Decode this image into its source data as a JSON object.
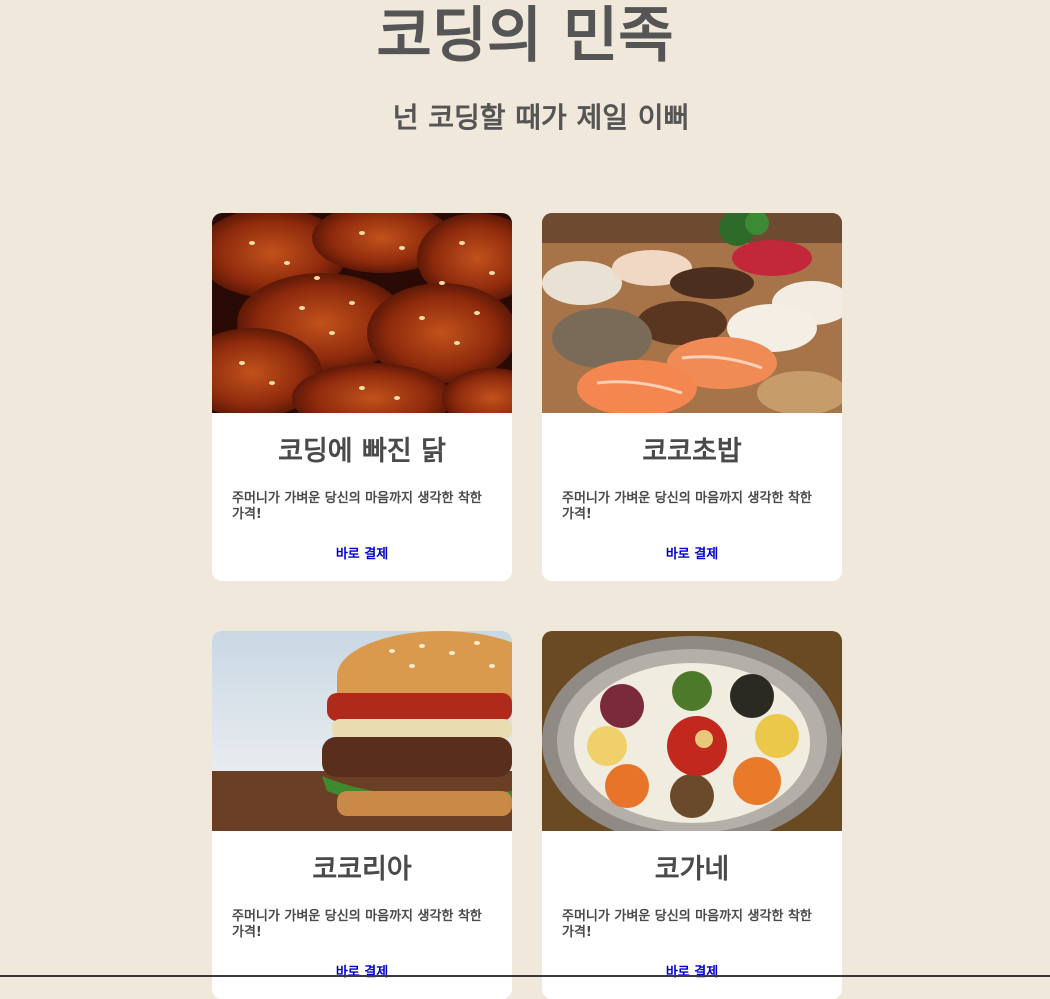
{
  "header": {
    "title": "코딩의 민족",
    "subtitle": "넌 코딩할 때가 제일 이뻐"
  },
  "cards": [
    {
      "title": "코딩에 빠진 닭",
      "description": "주머니가 가벼운 당신의 마음까지 생각한 착한 가격!",
      "link_label": "바로 결제",
      "image": "fried-chicken-photo"
    },
    {
      "title": "코코초밥",
      "description": "주머니가 가벼운 당신의 마음까지 생각한 착한 가격!",
      "link_label": "바로 결제",
      "image": "sushi-photo"
    },
    {
      "title": "코코리아",
      "description": "주머니가 가벼운 당신의 마음까지 생각한 착한 가격!",
      "link_label": "바로 결제",
      "image": "burger-photo"
    },
    {
      "title": "코가네",
      "description": "주머니가 가벼운 당신의 마음까지 생각한 착한 가격!",
      "link_label": "바로 결제",
      "image": "bibimbap-photo"
    }
  ],
  "colors": {
    "background": "#f0e8db",
    "card": "#ffffff",
    "heading": "#555555",
    "link": "#0000cc"
  }
}
